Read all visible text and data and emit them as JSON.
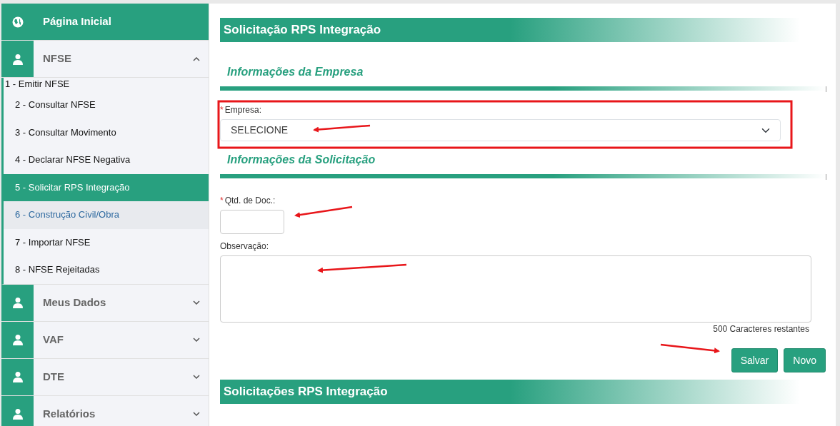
{
  "sidebar": [
    {
      "label": "Página Inicial",
      "kind": "link"
    },
    {
      "label": "NFSE",
      "kind": "section",
      "expanded": true,
      "children": [
        {
          "label": "1 - Emitir NFSE",
          "kind": "plain",
          "selected": false,
          "hovered": false
        },
        {
          "label": "2 - Consultar NFSE",
          "kind": "link",
          "selected": false,
          "hovered": false
        },
        {
          "label": "3 - Consultar Movimento",
          "kind": "link",
          "selected": false,
          "hovered": false
        },
        {
          "label": "4 - Declarar NFSE Negativa",
          "kind": "link",
          "selected": false,
          "hovered": false
        },
        {
          "label": "5 - Solicitar RPS Integração",
          "kind": "link",
          "selected": true,
          "hovered": false
        },
        {
          "label": "6 - Construção Civil/Obra",
          "kind": "link",
          "selected": false,
          "hovered": true
        },
        {
          "label": "7 - Importar NFSE",
          "kind": "link",
          "selected": false,
          "hovered": false
        },
        {
          "label": "8 - NFSE Rejeitadas",
          "kind": "link",
          "selected": false,
          "hovered": false
        }
      ]
    },
    {
      "label": "Meus Dados",
      "kind": "section",
      "expanded": false
    },
    {
      "label": "VAF",
      "kind": "section",
      "expanded": false
    },
    {
      "label": "DTE",
      "kind": "section",
      "expanded": false
    },
    {
      "label": "Relatórios",
      "kind": "section",
      "expanded": false
    }
  ],
  "page_title": "Solicitação RPS Integração",
  "company_section": {
    "title": "Informações da Empresa",
    "field": {
      "label": "Empresa:",
      "required_mark": "*",
      "value": "SELECIONE"
    }
  },
  "request_section": {
    "title": "Informações da Solicitação",
    "quantity": {
      "label": "Qtd. de Doc.:",
      "required_mark": "*"
    },
    "note": {
      "label": "Observação:",
      "counter": "500 Caracteres restantes"
    }
  },
  "buttons": [
    "Salvar",
    "Novo"
  ],
  "list_title": "Solicitações RPS Integração"
}
